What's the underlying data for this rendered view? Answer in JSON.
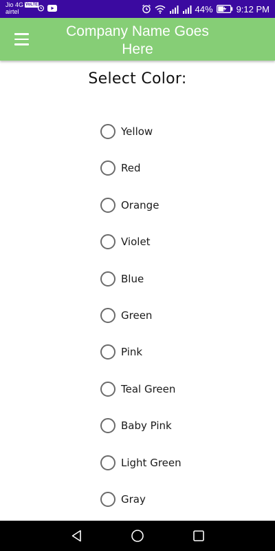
{
  "status_bar": {
    "carrier1": "Jio 4G",
    "volte": "VoLTE",
    "carrier2": "airtel",
    "battery": "44%",
    "time": "9:12 PM"
  },
  "app_bar": {
    "title": "Company Name Goes Here"
  },
  "page": {
    "heading": "Select Color:"
  },
  "options": [
    {
      "label": "Yellow",
      "selected": false
    },
    {
      "label": "Red",
      "selected": false
    },
    {
      "label": "Orange",
      "selected": false
    },
    {
      "label": "Violet",
      "selected": false
    },
    {
      "label": "Blue",
      "selected": false
    },
    {
      "label": "Green",
      "selected": false
    },
    {
      "label": "Pink",
      "selected": false
    },
    {
      "label": "Teal Green",
      "selected": false
    },
    {
      "label": "Baby Pink",
      "selected": false
    },
    {
      "label": "Light Green",
      "selected": false
    },
    {
      "label": "Gray",
      "selected": false
    }
  ],
  "colors": {
    "status_bar": "#3b0aa0",
    "app_bar": "#86ce76",
    "nav_bar": "#000000",
    "radio_border": "#6a6a6a"
  }
}
